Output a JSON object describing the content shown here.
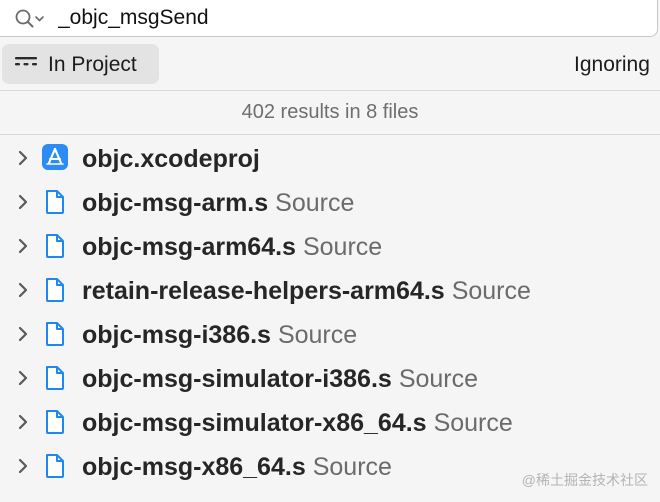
{
  "search": {
    "query": "_objc_msgSend",
    "icon": "magnifying-glass-with-dropdown"
  },
  "scope": {
    "label": "In Project",
    "icon": "list-lines-icon",
    "matching_label": "Ignoring"
  },
  "summary": "402 results in 8 files",
  "results": [
    {
      "name": "objc.xcodeproj",
      "kind": "",
      "icon": "xcode-project-icon"
    },
    {
      "name": "objc-msg-arm.s",
      "kind": "Source",
      "icon": "source-file-icon"
    },
    {
      "name": "objc-msg-arm64.s",
      "kind": "Source",
      "icon": "source-file-icon"
    },
    {
      "name": "retain-release-helpers-arm64.s",
      "kind": "Source",
      "icon": "source-file-icon"
    },
    {
      "name": "objc-msg-i386.s",
      "kind": "Source",
      "icon": "source-file-icon"
    },
    {
      "name": "objc-msg-simulator-i386.s",
      "kind": "Source",
      "icon": "source-file-icon"
    },
    {
      "name": "objc-msg-simulator-x86_64.s",
      "kind": "Source",
      "icon": "source-file-icon"
    },
    {
      "name": "objc-msg-x86_64.s",
      "kind": "Source",
      "icon": "source-file-icon"
    }
  ],
  "watermark": "@稀土掘金技术社区",
  "colors": {
    "accent": "#2a8cf4",
    "file_icon_stroke": "#1e88f0",
    "background": "#f5f5f5"
  }
}
